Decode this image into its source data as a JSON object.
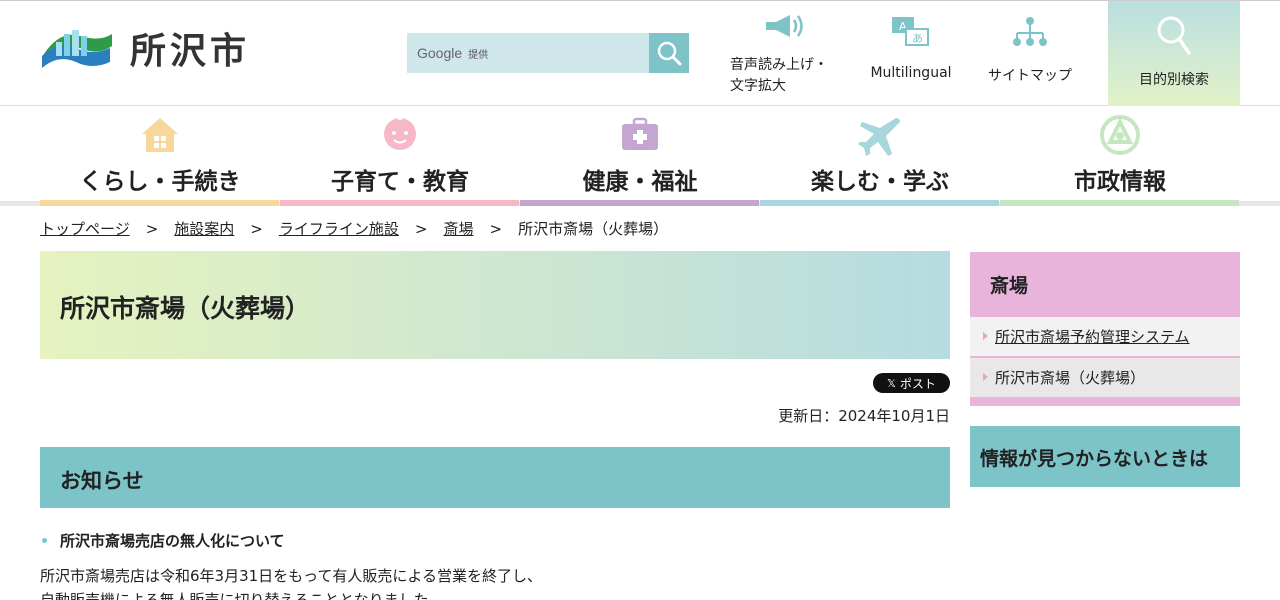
{
  "header": {
    "logo_text": "所沢市",
    "search": {
      "provider": "Google",
      "provided_label": "提供"
    },
    "voice_label_line1": "音声読み上げ・",
    "voice_label_line2": "文字拡大",
    "multilingual_label": "Multilingual",
    "sitemap_label": "サイトマップ",
    "purpose_label": "目的別検索"
  },
  "gnav": {
    "items": [
      {
        "label": "くらし・手続き",
        "color": "#f7d79a"
      },
      {
        "label": "子育て・教育",
        "color": "#f6b8c6"
      },
      {
        "label": "健康・福祉",
        "color": "#c4a6d1"
      },
      {
        "label": "楽しむ・学ぶ",
        "color": "#a8d6dd"
      },
      {
        "label": "市政情報",
        "color": "#c6e6bf"
      }
    ]
  },
  "breadcrumb": {
    "items": [
      "トップページ",
      "施設案内",
      "ライフライン施設",
      "斎場"
    ],
    "current": "所沢市斎場（火葬場）",
    "separator": ">"
  },
  "main": {
    "title": "所沢市斎場（火葬場）",
    "xpost_label": "ポスト",
    "updated": "更新日：2024年10月1日",
    "news_heading": "お知らせ",
    "news_item": "所沢市斎場売店の無人化について",
    "body_line1": "所沢市斎場売店は令和6年3月31日をもって有人販売による営業を終了し、",
    "body_line2": "自動販売機による無人販売に切り替えることとなりました。"
  },
  "sidebar": {
    "heading": "斎場",
    "items": [
      "所沢市斎場予約管理システム",
      "所沢市斎場（火葬場）"
    ],
    "notfound": "情報が見つからないときは"
  },
  "colors": {
    "teal": "#7dc4c9",
    "pink": "#e8b4dc"
  }
}
